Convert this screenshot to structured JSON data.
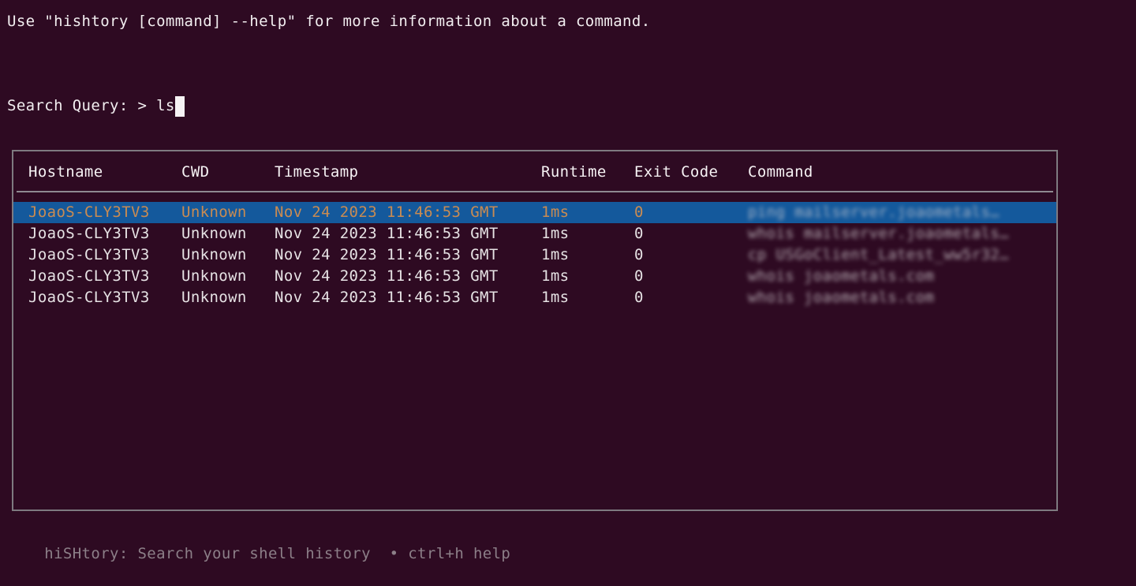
{
  "terminal": {
    "background_color": "#2e0a22",
    "foreground_color": "#f2eef0",
    "help_line": "Use \"hishtory [command] --help\" for more information about a command."
  },
  "search": {
    "label": "Search Query: ",
    "prompt": "> ",
    "value": "ls",
    "cursor": "block"
  },
  "table": {
    "border_color": "#7e7a80",
    "selection_background": "#14599c",
    "selection_foreground": "#c98b52",
    "columns": [
      {
        "key": "hostname",
        "label": "Hostname"
      },
      {
        "key": "cwd",
        "label": "CWD"
      },
      {
        "key": "timestamp",
        "label": "Timestamp"
      },
      {
        "key": "runtime",
        "label": "Runtime"
      },
      {
        "key": "exit_code",
        "label": "Exit Code"
      },
      {
        "key": "command",
        "label": "Command"
      }
    ],
    "rows": [
      {
        "selected": true,
        "hostname": "JoaoS-CLY3TV3",
        "cwd": "Unknown",
        "timestamp": "Nov 24 2023 11:46:53 GMT",
        "runtime": "1ms",
        "exit_code": "0",
        "command": "ping mailserver.joaometals…",
        "command_redacted": true
      },
      {
        "selected": false,
        "hostname": "JoaoS-CLY3TV3",
        "cwd": "Unknown",
        "timestamp": "Nov 24 2023 11:46:53 GMT",
        "runtime": "1ms",
        "exit_code": "0",
        "command": "whois mailserver.joaometals…",
        "command_redacted": true
      },
      {
        "selected": false,
        "hostname": "JoaoS-CLY3TV3",
        "cwd": "Unknown",
        "timestamp": "Nov 24 2023 11:46:53 GMT",
        "runtime": "1ms",
        "exit_code": "0",
        "command": "cp USGoClient_Latest_ww5r32…",
        "command_redacted": true
      },
      {
        "selected": false,
        "hostname": "JoaoS-CLY3TV3",
        "cwd": "Unknown",
        "timestamp": "Nov 24 2023 11:46:53 GMT",
        "runtime": "1ms",
        "exit_code": "0",
        "command": "whois joaometals.com",
        "command_redacted": true
      },
      {
        "selected": false,
        "hostname": "JoaoS-CLY3TV3",
        "cwd": "Unknown",
        "timestamp": "Nov 24 2023 11:46:53 GMT",
        "runtime": "1ms",
        "exit_code": "0",
        "command": "whois joaometals.com",
        "command_redacted": true
      }
    ]
  },
  "footer": {
    "app_name": "hiSHtory:",
    "tagline": " Search your shell history",
    "separator": "  • ",
    "shortcut": "ctrl+h help",
    "text_color": "#8c7f88"
  }
}
